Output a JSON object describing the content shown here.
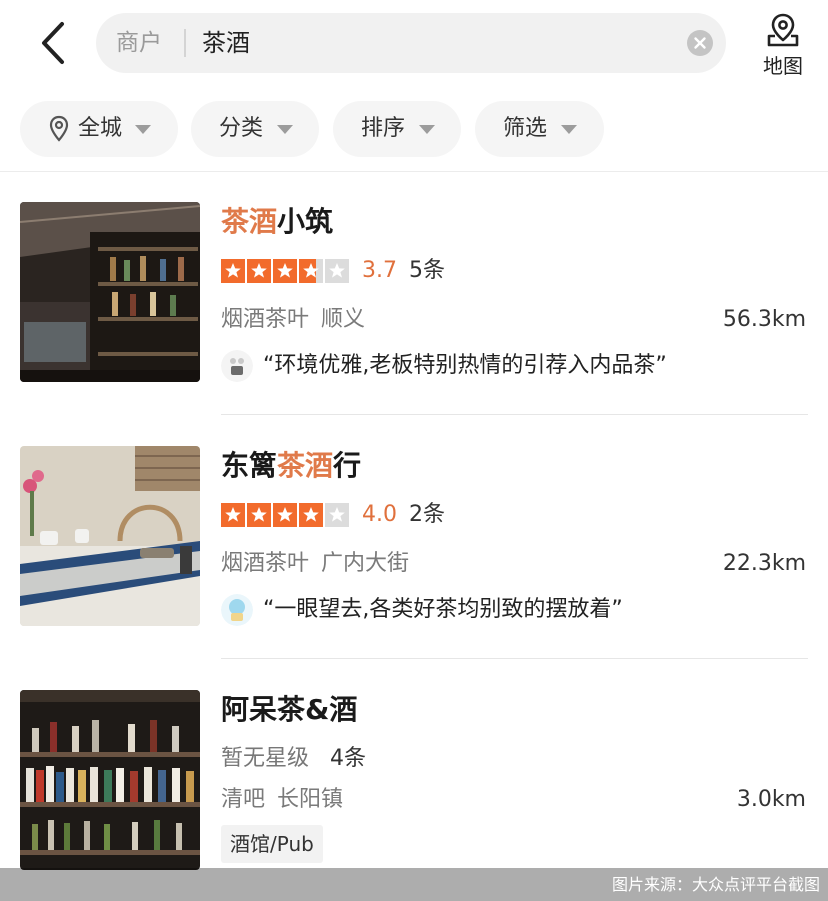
{
  "header": {
    "search_scope": "商户",
    "search_query": "茶酒",
    "map_label": "地图"
  },
  "filters": [
    {
      "label": "全城",
      "icon": "location-pin-icon"
    },
    {
      "label": "分类"
    },
    {
      "label": "排序"
    },
    {
      "label": "筛选"
    }
  ],
  "results": [
    {
      "name_highlight": "茶酒",
      "name_rest": "小筑",
      "rating": 3.7,
      "score": "3.7",
      "reviews": "5条",
      "category": "烟酒茶叶",
      "area": "顺义",
      "distance": "56.3km",
      "review_quote": "“环境优雅,老板特别热情的引荐入内品茶”"
    },
    {
      "name_prefix": "东篱",
      "name_highlight": "茶酒",
      "name_rest": "行",
      "rating": 4.0,
      "score": "4.0",
      "reviews": "2条",
      "category": "烟酒茶叶",
      "area": "广内大街",
      "distance": "22.3km",
      "review_quote": "“一眼望去,各类好茶均别致的摆放着”"
    },
    {
      "name": "阿呆茶&酒",
      "no_rating": "暂无星级",
      "reviews": "4条",
      "category": "清吧",
      "area": "长阳镇",
      "distance": "3.0km",
      "tag": "酒馆/Pub"
    }
  ],
  "credit": "图片来源：大众点评平台截图",
  "colors": {
    "highlight": "#e07a4a",
    "star_filled": "#f26b2c",
    "star_empty": "#dcdcdc"
  }
}
